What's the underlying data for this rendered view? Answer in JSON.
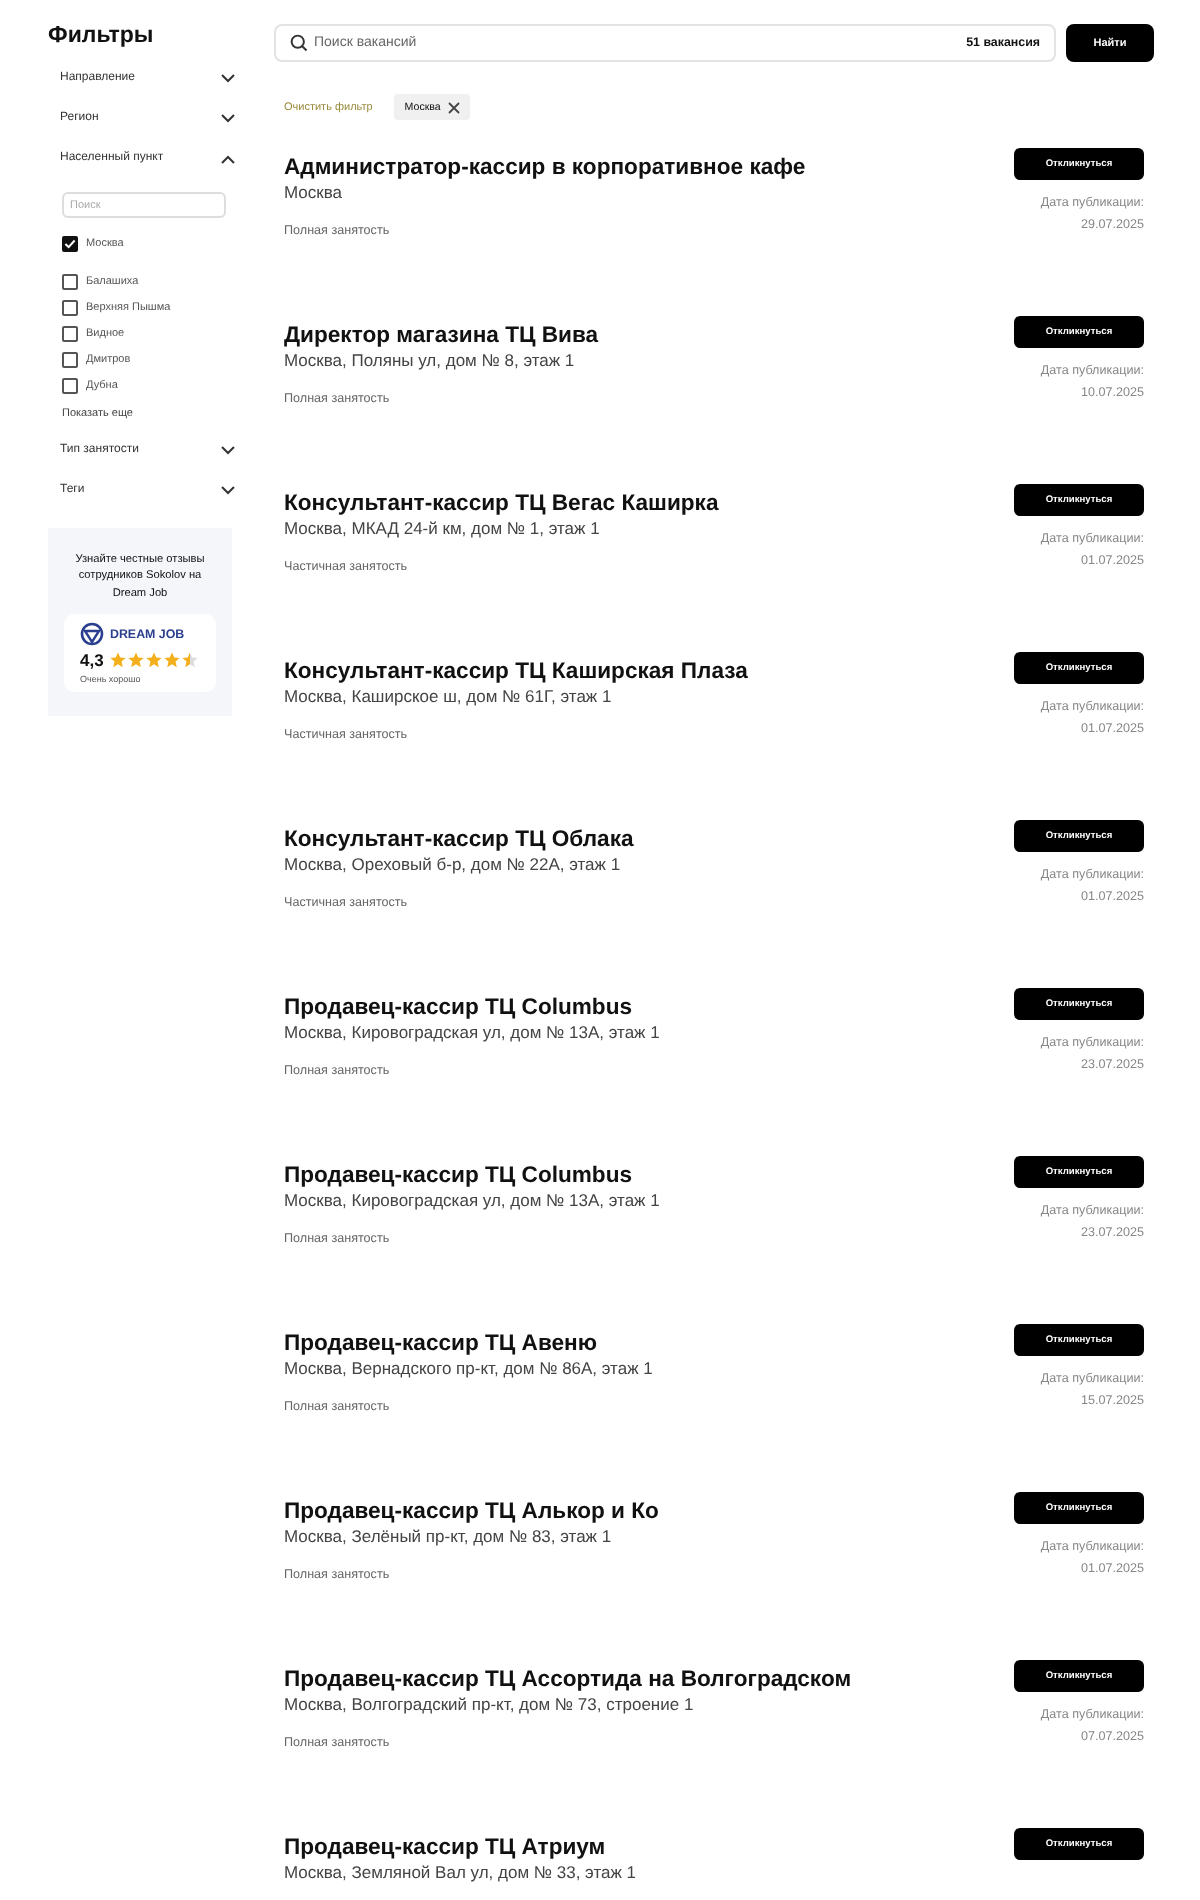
{
  "sidebar": {
    "title": "Фильтры",
    "filters": [
      {
        "label": "Направление",
        "expanded": false
      },
      {
        "label": "Регион",
        "expanded": false
      },
      {
        "label": "Населенный пункт",
        "expanded": true,
        "search": {
          "placeholder": "Поиск"
        },
        "options": [
          {
            "label": "Москва",
            "checked": true
          },
          {
            "label": "Балашиха",
            "checked": false
          },
          {
            "label": "Верхняя Пышма",
            "checked": false
          },
          {
            "label": "Видное",
            "checked": false
          },
          {
            "label": "Дмитров",
            "checked": false
          },
          {
            "label": "Дубна",
            "checked": false
          }
        ],
        "show_more": "Показать еще"
      },
      {
        "label": "Тип занятости",
        "expanded": false
      },
      {
        "label": "Теги",
        "expanded": false
      }
    ],
    "promo": {
      "text": "Узнайте честные отзывы сотрудников Sokolov на Dream Job",
      "brand": "DREAM JOB",
      "rating": "4,3",
      "stars": 4.5,
      "caption": "Очень хорошо"
    }
  },
  "search": {
    "placeholder": "Поиск вакансий",
    "count": "51 вакансия",
    "button": "Найти"
  },
  "active_filters": {
    "clear": "Очистить фильтр",
    "chips": [
      "Москва"
    ]
  },
  "vacancies": [
    {
      "title": "Администратор-кассир в корпоративное кафе",
      "address": "Москва",
      "employment": "Полная занятость",
      "button": "Откликнуться",
      "date_label": "Дата публикации:",
      "date": "29.07.2025"
    },
    {
      "title": "Директор магазина ТЦ Вива",
      "address": "Москва, Поляны ул, дом № 8, этаж 1",
      "employment": "Полная занятость",
      "button": "Откликнуться",
      "date_label": "Дата публикации:",
      "date": "10.07.2025"
    },
    {
      "title": "Консультант-кассир ТЦ Вегас Каширка",
      "address": "Москва, МКАД 24-й км, дом № 1, этаж 1",
      "employment": "Частичная занятость",
      "button": "Откликнуться",
      "date_label": "Дата публикации:",
      "date": "01.07.2025"
    },
    {
      "title": "Консультант-кассир ТЦ Каширская Плаза",
      "address": "Москва, Каширское ш, дом № 61Г, этаж 1",
      "employment": "Частичная занятость",
      "button": "Откликнуться",
      "date_label": "Дата публикации:",
      "date": "01.07.2025"
    },
    {
      "title": "Консультант-кассир ТЦ Облака",
      "address": "Москва, Ореховый б-р, дом № 22А, этаж 1",
      "employment": "Частичная занятость",
      "button": "Откликнуться",
      "date_label": "Дата публикации:",
      "date": "01.07.2025"
    },
    {
      "title": "Продавец-кассир ТЦ Columbus",
      "address": "Москва, Кировоградская ул, дом № 13А, этаж 1",
      "employment": "Полная занятость",
      "button": "Откликнуться",
      "date_label": "Дата публикации:",
      "date": "23.07.2025"
    },
    {
      "title": "Продавец-кассир ТЦ Columbus",
      "address": "Москва, Кировоградская ул, дом № 13А, этаж 1",
      "employment": "Полная занятость",
      "button": "Откликнуться",
      "date_label": "Дата публикации:",
      "date": "23.07.2025"
    },
    {
      "title": "Продавец-кассир ТЦ Авеню",
      "address": "Москва, Вернадского пр-кт, дом № 86А, этаж 1",
      "employment": "Полная занятость",
      "button": "Откликнуться",
      "date_label": "Дата публикации:",
      "date": "15.07.2025"
    },
    {
      "title": "Продавец-кассир ТЦ Алькор и Ко",
      "address": "Москва, Зелёный пр-кт, дом № 83, этаж 1",
      "employment": "Полная занятость",
      "button": "Откликнуться",
      "date_label": "Дата публикации:",
      "date": "01.07.2025"
    },
    {
      "title": "Продавец-кассир ТЦ Ассортида на Волгоградском",
      "address": "Москва, Волгоградский пр-кт, дом № 73, строение 1",
      "employment": "Полная занятость",
      "button": "Откликнуться",
      "date_label": "Дата публикации:",
      "date": "07.07.2025"
    },
    {
      "title": "Продавец-кассир ТЦ Атриум",
      "address": "Москва, Земляной Вал ул, дом № 33, этаж 1",
      "button": "Откликнуться"
    }
  ]
}
